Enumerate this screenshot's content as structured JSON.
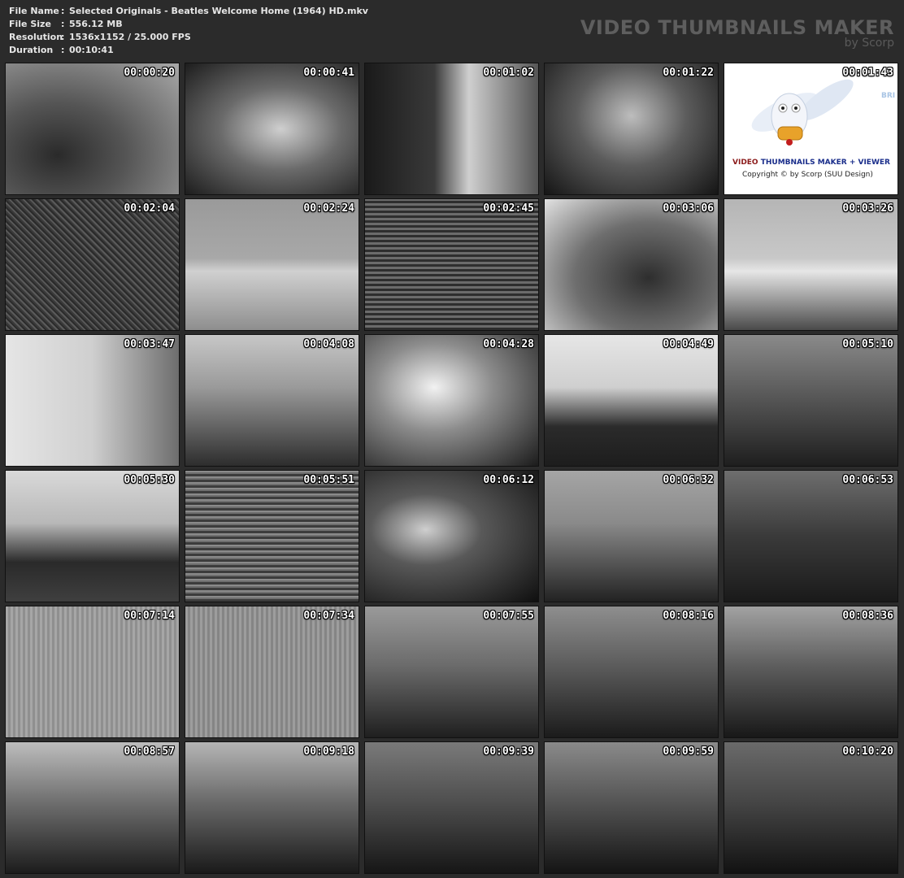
{
  "meta": {
    "file_name_label": "File Name",
    "file_name": "Selected Originals - Beatles Welcome Home (1964) HD.mkv",
    "file_size_label": "File Size",
    "file_size": "556.12 MB",
    "resolution_label": "Resolution",
    "resolution": "1536x1152 / 25.000 FPS",
    "duration_label": "Duration",
    "duration": "00:10:41",
    "separator": ":"
  },
  "brand": {
    "title": "VIDEO THUMBNAILS MAKER",
    "subtitle": "by Scorp"
  },
  "logo": {
    "title_part1": "VIDEO ",
    "title_part2": "THUMBNAILS MAKER + VIEWER",
    "copyright": "Copyright © by Scorp (SUU Design)",
    "partial_text": "BRI"
  },
  "thumbnails": [
    "00:00:20",
    "00:00:41",
    "00:01:02",
    "00:01:22",
    "00:01:43",
    "00:02:04",
    "00:02:24",
    "00:02:45",
    "00:03:06",
    "00:03:26",
    "00:03:47",
    "00:04:08",
    "00:04:28",
    "00:04:49",
    "00:05:10",
    "00:05:30",
    "00:05:51",
    "00:06:12",
    "00:06:32",
    "00:06:53",
    "00:07:14",
    "00:07:34",
    "00:07:55",
    "00:08:16",
    "00:08:36",
    "00:08:57",
    "00:09:18",
    "00:09:39",
    "00:09:59",
    "00:10:20"
  ]
}
